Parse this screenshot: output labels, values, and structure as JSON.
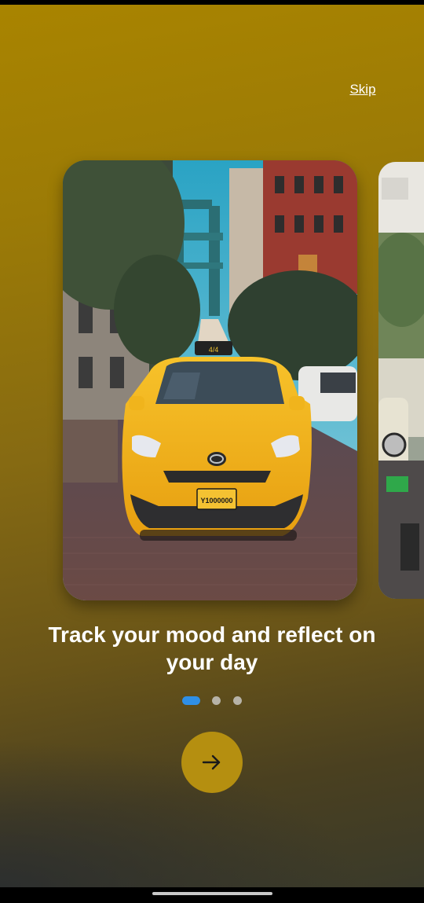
{
  "skip": {
    "label": "Skip"
  },
  "slide": {
    "title": "Track your mood and reflect on your day",
    "image_subject": "yellow-taxi-street-photo",
    "plate_text": "Y1000000",
    "roof_sign_text": "4/4"
  },
  "pagination": {
    "total": 3,
    "active_index": 0,
    "active_color": "#2f8fe6",
    "inactive_color": "#b7b3a8"
  },
  "next_button": {
    "icon": "arrow-right-icon",
    "color": "#b58f10"
  },
  "colors": {
    "background_top": "#a98400",
    "background_bottom": "#3a3a2a",
    "taxi_yellow": "#f2b318"
  }
}
